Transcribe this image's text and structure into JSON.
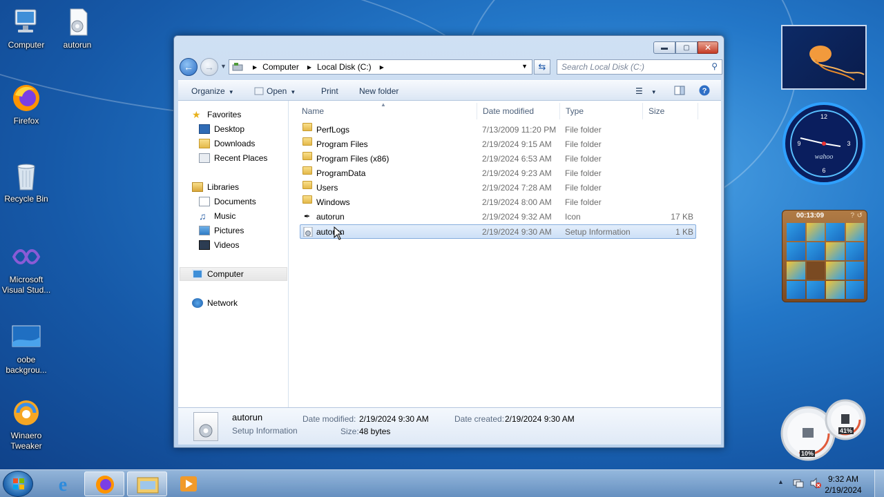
{
  "desktop": {
    "icons": [
      {
        "label": "Computer"
      },
      {
        "label": "autorun"
      },
      {
        "label": "Firefox"
      },
      {
        "label": "Recycle Bin"
      },
      {
        "label": "Microsoft Visual Stud..."
      },
      {
        "label": "oobe backgrou..."
      },
      {
        "label": "Winaero Tweaker"
      }
    ]
  },
  "explorer": {
    "breadcrumb": [
      "Computer",
      "Local Disk (C:)"
    ],
    "search_placeholder": "Search Local Disk (C:)",
    "toolbar": {
      "organize": "Organize",
      "open": "Open",
      "print": "Print",
      "new_folder": "New folder"
    },
    "nav": {
      "favorites": "Favorites",
      "desktop": "Desktop",
      "downloads": "Downloads",
      "recent": "Recent Places",
      "libraries": "Libraries",
      "documents": "Documents",
      "music": "Music",
      "pictures": "Pictures",
      "videos": "Videos",
      "computer": "Computer",
      "network": "Network"
    },
    "columns": {
      "name": "Name",
      "date": "Date modified",
      "type": "Type",
      "size": "Size"
    },
    "files": [
      {
        "name": "PerfLogs",
        "date": "7/13/2009 11:20 PM",
        "type": "File folder",
        "size": ""
      },
      {
        "name": "Program Files",
        "date": "2/19/2024 9:15 AM",
        "type": "File folder",
        "size": ""
      },
      {
        "name": "Program Files (x86)",
        "date": "2/19/2024 6:53 AM",
        "type": "File folder",
        "size": ""
      },
      {
        "name": "ProgramData",
        "date": "2/19/2024 9:23 AM",
        "type": "File folder",
        "size": ""
      },
      {
        "name": "Users",
        "date": "2/19/2024 7:28 AM",
        "type": "File folder",
        "size": ""
      },
      {
        "name": "Windows",
        "date": "2/19/2024 8:00 AM",
        "type": "File folder",
        "size": ""
      },
      {
        "name": "autorun",
        "date": "2/19/2024 9:32 AM",
        "type": "Icon",
        "size": "17 KB"
      },
      {
        "name": "autorun",
        "date": "2/19/2024 9:30 AM",
        "type": "Setup Information",
        "size": "1 KB"
      }
    ],
    "details": {
      "name": "autorun",
      "type": "Setup Information",
      "date_modified_label": "Date modified:",
      "date_modified": "2/19/2024 9:30 AM",
      "date_created_label": "Date created:",
      "date_created": "2/19/2024 9:30 AM",
      "size_label": "Size:",
      "size": "48 bytes"
    }
  },
  "gadgets": {
    "puzzle_timer": "00:13:09",
    "clock_brand": "wahoo",
    "cpu": "10%",
    "mem": "41%"
  },
  "taskbar": {
    "time": "9:32 AM",
    "date": "2/19/2024"
  },
  "colors": {
    "accent": "#2377c8",
    "selection": "#cde0f7",
    "close_button": "#c43b25"
  }
}
